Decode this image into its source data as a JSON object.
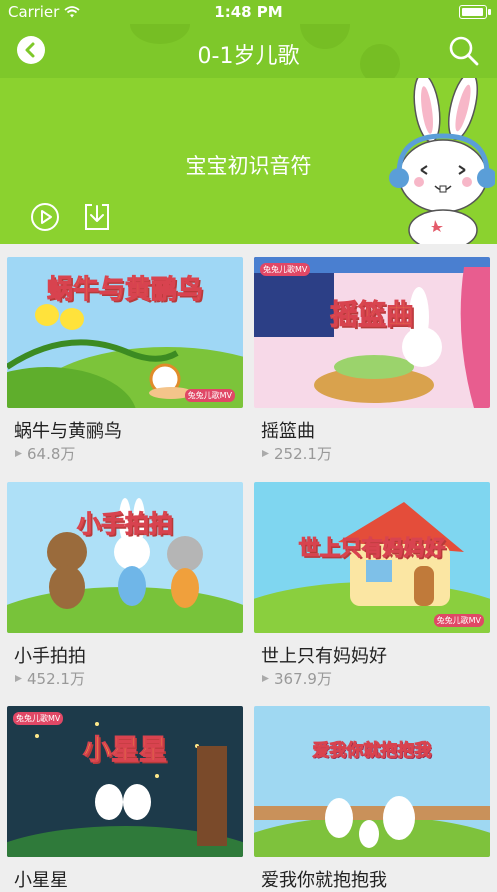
{
  "status_bar": {
    "carrier": "Carrier",
    "time": "1:48 PM"
  },
  "header": {
    "title": "0-1岁儿歌"
  },
  "hero": {
    "subtitle": "宝宝初识音符"
  },
  "songs": [
    {
      "title": "蜗牛与黄鹂鸟",
      "plays": "64.8万",
      "thumb_text": "蜗牛与黄鹂鸟",
      "badge": "兔兔儿歌MV"
    },
    {
      "title": "摇篮曲",
      "plays": "252.1万",
      "thumb_text": "摇篮曲",
      "badge": "兔兔儿歌MV"
    },
    {
      "title": "小手拍拍",
      "plays": "452.1万",
      "thumb_text": "小手拍拍",
      "badge": ""
    },
    {
      "title": "世上只有妈妈好",
      "plays": "367.9万",
      "thumb_text": "世上只有妈妈好",
      "badge": "兔兔儿歌MV"
    },
    {
      "title": "小星星",
      "plays": "",
      "thumb_text": "小星星",
      "badge": "兔兔儿歌MV"
    },
    {
      "title": "爱我你就抱抱我",
      "plays": "",
      "thumb_text": "爱我你就抱抱我",
      "badge": ""
    }
  ],
  "icons": {
    "back": "chevron-left-icon",
    "search": "search-icon",
    "play": "play-circle-icon",
    "download": "download-icon",
    "plays": "play-count-icon",
    "mascot": "bunny-headphones-illustration"
  },
  "colors": {
    "brand_green": "#7ec82a",
    "hero_green": "#8bd22f",
    "background": "#eeeeee"
  }
}
